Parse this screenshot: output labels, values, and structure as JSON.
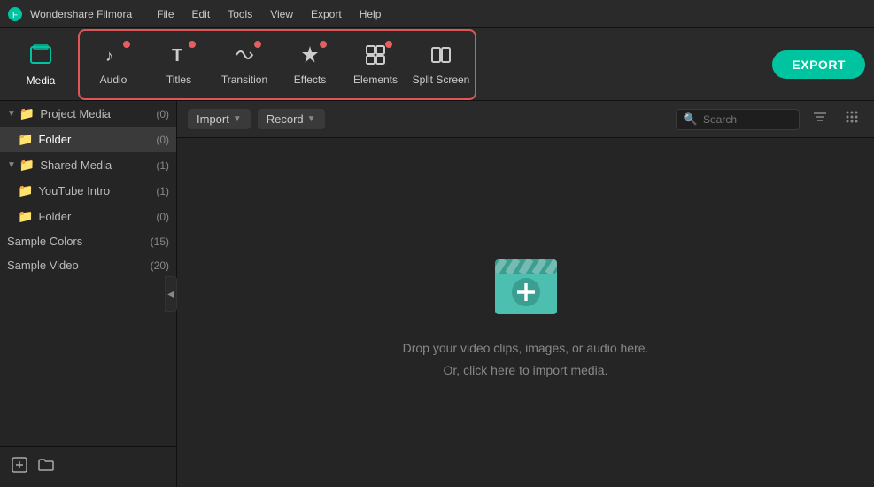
{
  "titlebar": {
    "logo_symbol": "🎬",
    "app_name": "Wondershare Filmora",
    "menu_items": [
      "File",
      "Edit",
      "Tools",
      "View",
      "Export",
      "Help"
    ]
  },
  "toolbar": {
    "items": [
      {
        "id": "media",
        "label": "Media",
        "icon": "☰",
        "has_dot": false,
        "active": true
      },
      {
        "id": "audio",
        "label": "Audio",
        "icon": "♪",
        "has_dot": true,
        "active": false
      },
      {
        "id": "titles",
        "label": "Titles",
        "icon": "T",
        "has_dot": true,
        "active": false
      },
      {
        "id": "transition",
        "label": "Transition",
        "icon": "⇄",
        "has_dot": true,
        "active": false
      },
      {
        "id": "effects",
        "label": "Effects",
        "icon": "✦",
        "has_dot": true,
        "active": false
      },
      {
        "id": "elements",
        "label": "Elements",
        "icon": "⊞",
        "has_dot": true,
        "active": false
      },
      {
        "id": "split_screen",
        "label": "Split Screen",
        "icon": "▦",
        "has_dot": false,
        "active": false
      }
    ],
    "export_label": "EXPORT"
  },
  "sidebar": {
    "project_media": {
      "label": "Project Media",
      "count": "(0)"
    },
    "folder_selected": {
      "label": "Folder",
      "count": "(0)"
    },
    "shared_media": {
      "label": "Shared Media",
      "count": "(1)"
    },
    "youtube_intro": {
      "label": "YouTube Intro",
      "count": "(1)"
    },
    "folder_sub": {
      "label": "Folder",
      "count": "(0)"
    },
    "sample_colors": {
      "label": "Sample Colors",
      "count": "(15)"
    },
    "sample_video": {
      "label": "Sample Video",
      "count": "(20)"
    },
    "footer_add_icon": "⊞",
    "footer_folder_icon": "🗀"
  },
  "content": {
    "import_label": "Import",
    "record_label": "Record",
    "search_placeholder": "Search",
    "drop_line1": "Drop your video clips, images, or audio here.",
    "drop_line2": "Or, click here to import media."
  }
}
